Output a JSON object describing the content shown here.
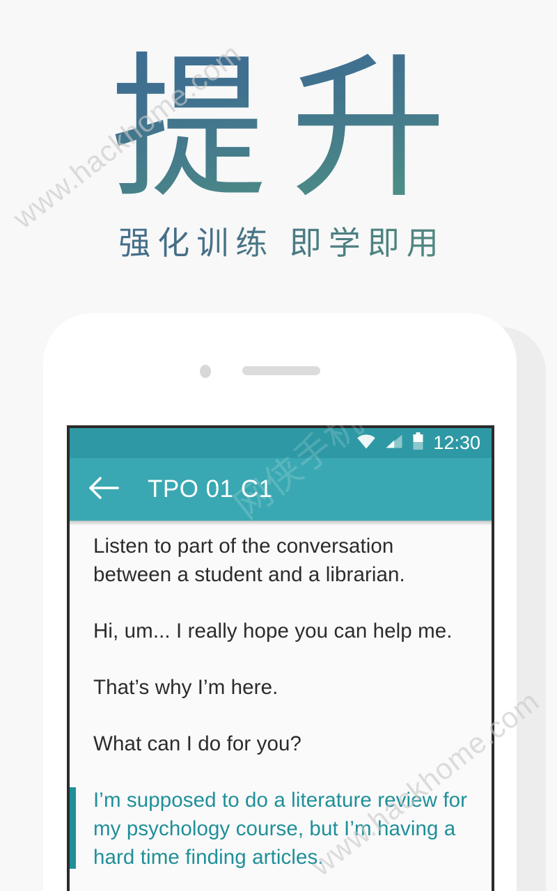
{
  "promo": {
    "headline": "提升",
    "subtitle": "强化训练 即学即用",
    "headline_gradient_from": "#3d6b94",
    "headline_gradient_to": "#539683"
  },
  "watermarks": {
    "site_top": "www.hackhome.com",
    "site_bottom": "www.hackhome.com",
    "site_cn": "网侠手机"
  },
  "phone": {
    "status_bar": {
      "time": "12:30",
      "background": "#2e99a4",
      "icons": [
        "wifi-icon",
        "cellular-signal-icon",
        "battery-icon"
      ]
    },
    "app_bar": {
      "title": "TPO 01 C1",
      "back_icon": "arrow-left-icon",
      "background": "#3aa8b2"
    },
    "transcript": {
      "accent_color": "#1f8f99",
      "paragraphs": [
        {
          "text": "Listen to part of the conversation between a student and a librarian.",
          "active": false
        },
        {
          "text": "Hi, um... I really hope you can help me.",
          "active": false
        },
        {
          "text": "That’s why I’m here.",
          "active": false
        },
        {
          "text": "What can I do for you?",
          "active": false
        },
        {
          "text": "I’m supposed to do a literature review for my psychology course, but I’m having a hard time finding articles.",
          "active": true
        }
      ]
    }
  }
}
